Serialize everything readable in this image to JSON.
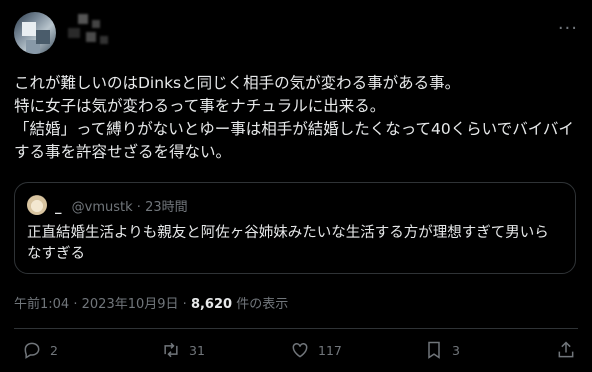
{
  "tweet": {
    "text": "これが難しいのはDinksと同じく相手の気が変わる事がある事。\n特に女子は気が変わるって事をナチュラルに出来る。\n「結婚」って縛りがないとゆー事は相手が結婚したくなって40くらいでバイバイする事を許容せざるを得ない。",
    "more_label": "···"
  },
  "quote": {
    "name": "_",
    "handle": "@vmustk",
    "separator": "·",
    "time": "23時間",
    "text": "正直結婚生活よりも親友と阿佐ヶ谷姉妹みたいな生活する方が理想すぎて男いらなすぎる"
  },
  "meta": {
    "time": "午前1:04",
    "separator": "·",
    "date": "2023年10月9日",
    "separator2": "·",
    "views_count": "8,620",
    "views_label": "件の表示"
  },
  "actions": {
    "reply_count": "2",
    "retweet_count": "31",
    "like_count": "117",
    "bookmark_count": "3",
    "icons": [
      "reply-icon",
      "retweet-icon",
      "like-icon",
      "bookmark-icon",
      "share-icon"
    ]
  }
}
